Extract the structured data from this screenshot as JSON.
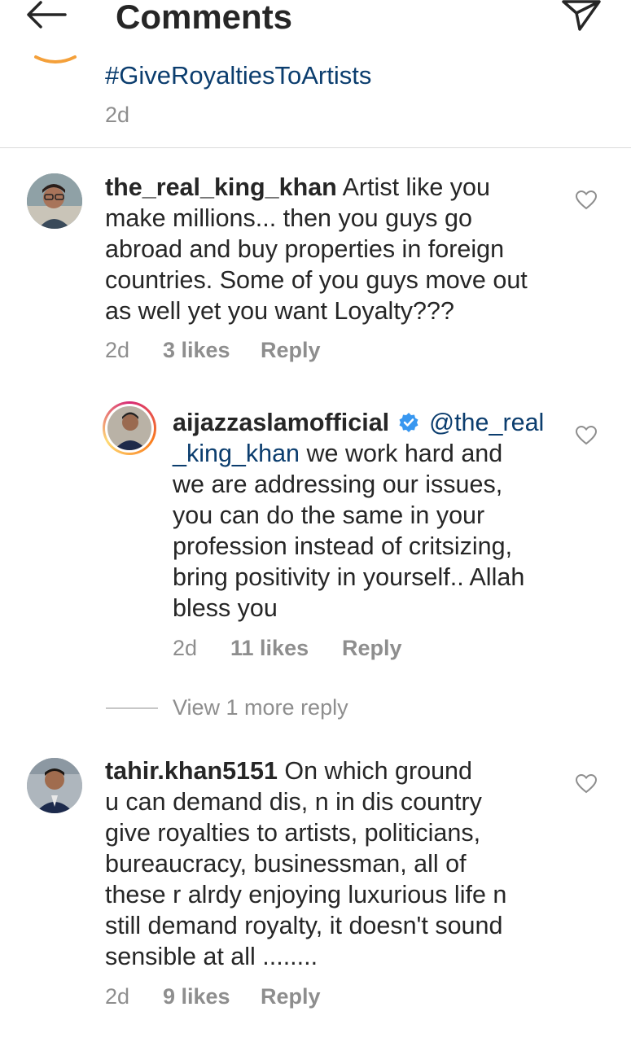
{
  "header": {
    "title": "Comments",
    "back_icon": "arrow-left-icon",
    "share_icon": "paper-plane-icon"
  },
  "top_comment": {
    "text": "#GiveRoyaltiesToArtists",
    "time": "2d"
  },
  "comments": [
    {
      "username": "the_real_king_khan",
      "lines": [
        " Artist like you",
        "make millions... then you guys go",
        "abroad and buy properties in foreign",
        "countries. Some of you guys move out",
        "as well yet you want Loyalty???"
      ],
      "time": "2d",
      "likes": "3 likes",
      "reply": "Reply"
    },
    {
      "username": "aijazzaslamofficial",
      "mention_part1": "@the_real",
      "mention_part2": "_king_khan",
      "line2_rest": " we work hard and",
      "lines": [
        "we are addressing our issues,",
        "you can do the same in your",
        "profession instead of critsizing,",
        "bring positivity in yourself.. Allah",
        "bless you"
      ],
      "time": "2d",
      "likes": "11 likes",
      "reply": "Reply",
      "verified": true
    },
    {
      "username": "tahir.khan5151",
      "lines": [
        " On which ground",
        "u can demand dis, n in dis country",
        "give royalties to artists, politicians,",
        "bureaucracy, businessman, all of",
        "these r alrdy enjoying luxurious life n",
        "still demand royalty,  it doesn't sound",
        "sensible at all ........"
      ],
      "time": "2d",
      "likes": "9 likes",
      "reply": "Reply"
    }
  ],
  "view_more": "View 1 more reply",
  "colors": {
    "link": "#0b3d6e",
    "muted": "#8e8e8e",
    "verified": "#3897f0"
  }
}
